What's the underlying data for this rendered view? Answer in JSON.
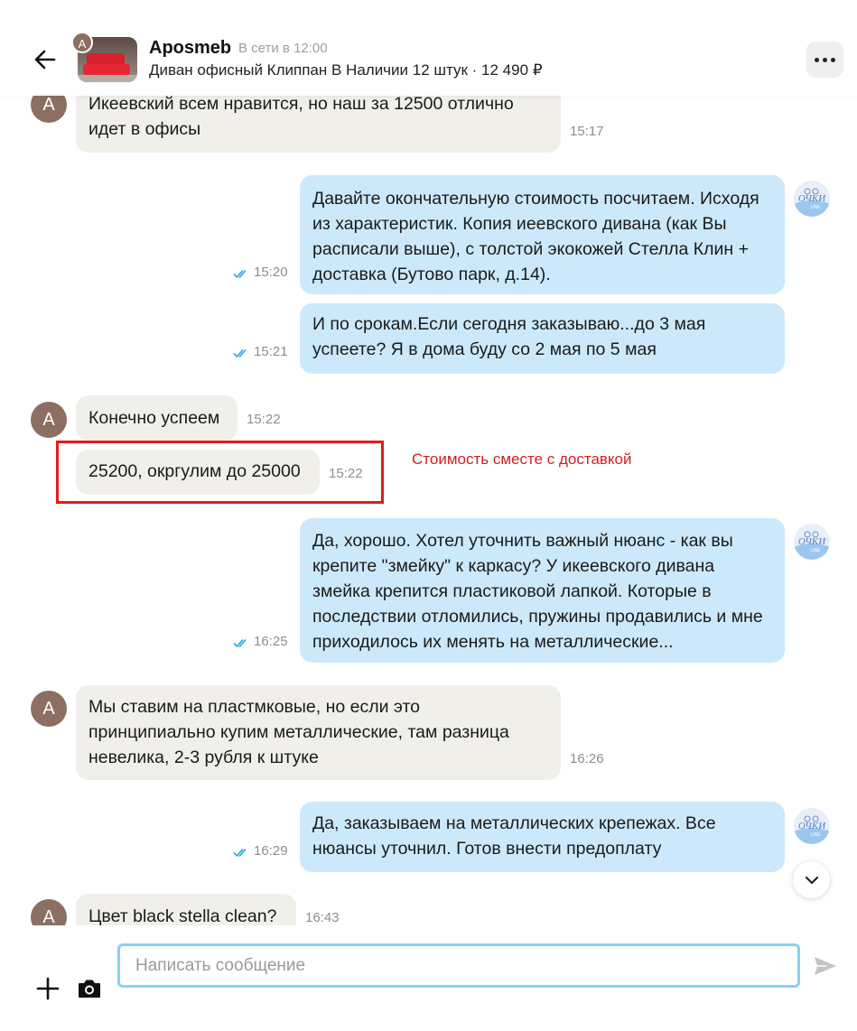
{
  "header": {
    "seller_name": "Aposmeb",
    "seller_status": "В сети в 12:00",
    "seller_initial": "А",
    "listing_title": "Диван офисный Клиппан В Наличии 12 штук · 12 490 ₽"
  },
  "messages": [
    {
      "from": "seller",
      "text": "Икеевский всем нравится, но наш за 12500 отлично идет в офисы",
      "time": "15:17"
    },
    {
      "from": "me",
      "text": "Давайте окончательную стоимость посчитаем. Исходя из характеристик. Копия иеевского дивана (как Вы расписали выше), с толстой экокожей Стелла Клин + доставка (Бутово парк, д.14).",
      "time": "15:20"
    },
    {
      "from": "me",
      "text": "И по срокам.Если сегодня заказываю...до 3 мая успеете? Я в дома буду со 2 мая по 5 мая",
      "time": "15:21"
    },
    {
      "from": "seller",
      "text": "Конечно успеем",
      "time": "15:22"
    },
    {
      "from": "seller",
      "text": "25200, окргулим до 25000",
      "time": "15:22"
    },
    {
      "from": "me",
      "text": "Да, хорошо. Хотел уточнить важный нюанс - как вы крепите \"змейку\" к каркасу? У икеевского дивана змейка крепится пластиковой лапкой. Которые в последствии отломились, пружины продавились и мне приходилось их менять на металлические...",
      "time": "16:25"
    },
    {
      "from": "seller",
      "text": "Мы ставим на пластмковые, но если это принципиально купим металлические, там разница невелика, 2-3 рубля к штуке",
      "time": "16:26"
    },
    {
      "from": "me",
      "text": "Да, заказываем на металлических крепежах. Все нюансы уточнил. Готов внести предоплату",
      "time": "16:29"
    },
    {
      "from": "seller",
      "text": "Цвет black stella clean?",
      "time": "16:43"
    }
  ],
  "annotation": {
    "text": "Стоимость сместе с доставкой",
    "color": "#e31b1b"
  },
  "my_avatar": {
    "text": "ОЧКИ",
    "sub": "LINE"
  },
  "composer": {
    "placeholder": "Написать сообщение",
    "value": ""
  },
  "colors": {
    "incoming_bubble": "#f1efea",
    "outgoing_bubble": "#cce9fb",
    "input_border": "#8ad1ec",
    "read_check": "#2aa4e0"
  },
  "icons": [
    "back-arrow-icon",
    "more-dots-icon",
    "double-check-icon",
    "chevron-down-icon",
    "plus-icon",
    "camera-icon",
    "send-icon"
  ]
}
